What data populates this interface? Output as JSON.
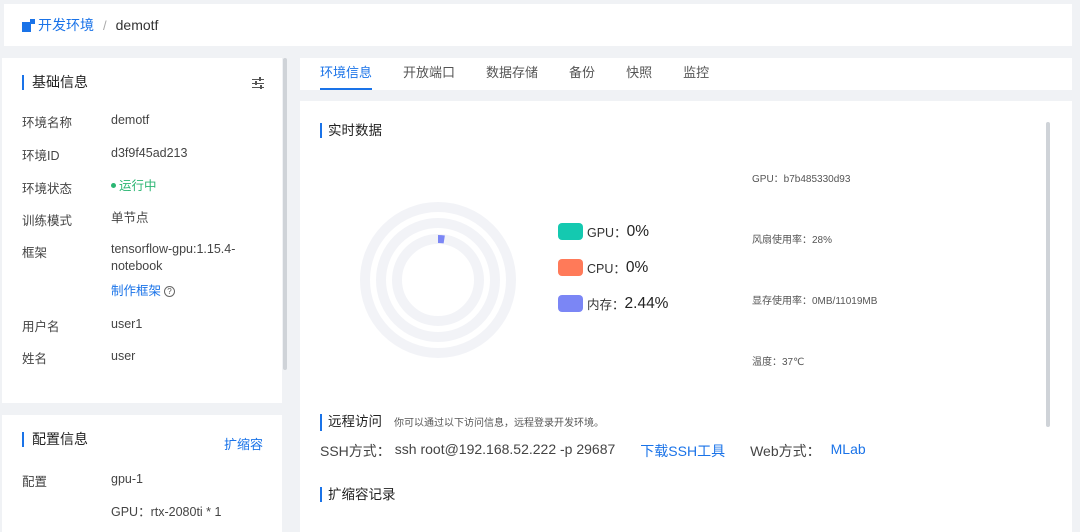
{
  "breadcrumb": {
    "root": "开发环境",
    "separator": "/",
    "current": "demotf"
  },
  "basic_info": {
    "title": "基础信息",
    "rows": [
      {
        "label": "环境名称",
        "value": "demotf"
      },
      {
        "label": "环境ID",
        "value": "d3f9f45ad213"
      },
      {
        "label": "环境状态",
        "value": "运行中"
      },
      {
        "label": "训练模式",
        "value": "单节点"
      },
      {
        "label": "框架",
        "value": "tensorflow-gpu:1.15.4-notebook",
        "link": "制作框架"
      },
      {
        "label": "用户名",
        "value": "user1"
      },
      {
        "label": "姓名",
        "value": "user"
      }
    ]
  },
  "config_info": {
    "title": "配置信息",
    "action": "扩缩容",
    "rows": [
      {
        "label": "配置",
        "value": "gpu-1"
      },
      {
        "label": "",
        "value": "GPU：rtx-2080ti * 1"
      }
    ]
  },
  "tabs": [
    "环境信息",
    "开放端口",
    "数据存储",
    "备份",
    "快照",
    "监控"
  ],
  "realtime": {
    "title": "实时数据",
    "legend": [
      {
        "name": "GPU：",
        "value": "0%",
        "color": "#14c9b0",
        "fraction": 0
      },
      {
        "name": "CPU：",
        "value": "0%",
        "color": "#ff7a59",
        "fraction": 0
      },
      {
        "name": "内存：",
        "value": "2.44%",
        "color": "#7b86f5",
        "fraction": 0.0244
      }
    ],
    "ring_color": "#f2f3f7",
    "gpu_info": [
      {
        "text": "GPU：b7b485330d93"
      },
      {
        "text": "风扇使用率：28%"
      },
      {
        "text": "显存使用率：0MB/11019MB"
      },
      {
        "text": "温度：37℃"
      }
    ]
  },
  "remote": {
    "title": "远程访问",
    "desc": "你可以通过以下访问信息，远程登录开发环境。",
    "ssh_label": "SSH方式：",
    "ssh_cmd": "ssh root@192.168.52.222 -p 29687",
    "ssh_tool_link": "下载SSH工具",
    "web_label": "Web方式：",
    "web_link": "MLab"
  },
  "scale_log": {
    "title": "扩缩容记录"
  },
  "colors": {
    "accent": "#1a73e8",
    "running": "#2bb673"
  }
}
